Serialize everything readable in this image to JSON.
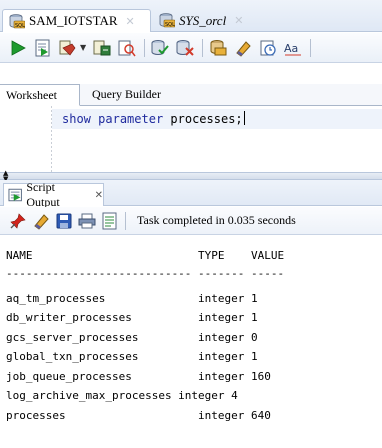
{
  "connection_tabs": [
    {
      "label": "SAM_IOTSTAR",
      "icon": "sql-database-icon",
      "active": true
    },
    {
      "label": "SYS_orcl",
      "icon": "sql-database-icon",
      "active": false
    }
  ],
  "worksheet_tabs": [
    {
      "label": "Worksheet",
      "active": true
    },
    {
      "label": "Query Builder",
      "active": false
    }
  ],
  "editor": {
    "code_keyword1": "show",
    "code_keyword2": "parameter",
    "code_rest": "processes;"
  },
  "output_panel": {
    "tab_label": "Script Output",
    "status_text": "Task completed in 0.035 seconds"
  },
  "results": {
    "header": "NAME                         TYPE    VALUE",
    "separator": "---------------------------- ------- -----",
    "rows": [
      "aq_tm_processes              integer 1",
      "db_writer_processes          integer 1",
      "gcs_server_processes         integer 0",
      "global_txn_processes         integer 1",
      "job_queue_processes          integer 160",
      "log_archive_max_processes integer 4",
      "processes                    integer 640"
    ]
  },
  "colors": {
    "keyword": "#1f2a9e",
    "tab_border": "#b9c7dc",
    "current_line": "#eef3fb"
  }
}
